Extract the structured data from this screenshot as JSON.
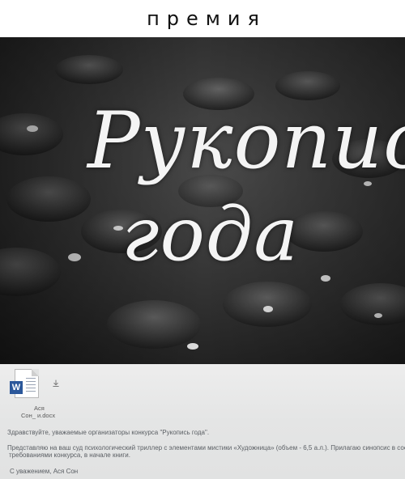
{
  "header": {
    "title": "премия"
  },
  "poster": {
    "title_line_1": "Рукопись",
    "title_line_2": "года"
  },
  "email": {
    "attachment": {
      "name_line_1": "Ася",
      "name_line_2": "Сон_   и.docx",
      "badge": "W"
    },
    "greeting": "Здравствуйте, уважаемые организаторы конкурса \"Рукопись года\".",
    "body_line_1": "Представляю на ваш суд психологический триллер с элементами мистики «Художница» (объем - 6,5 а.л.). Прилагаю синопсис в соответствии с",
    "body_line_2": "требованиями конкурса, в начале книги.",
    "signature": "С уважением, Ася Сон"
  },
  "colors": {
    "poster_bg": "#2f2f2f",
    "title_text": "#f4f4f4",
    "email_bg": "#e4e5e5",
    "email_text": "#5a5e63",
    "word_blue": "#2b579a"
  }
}
